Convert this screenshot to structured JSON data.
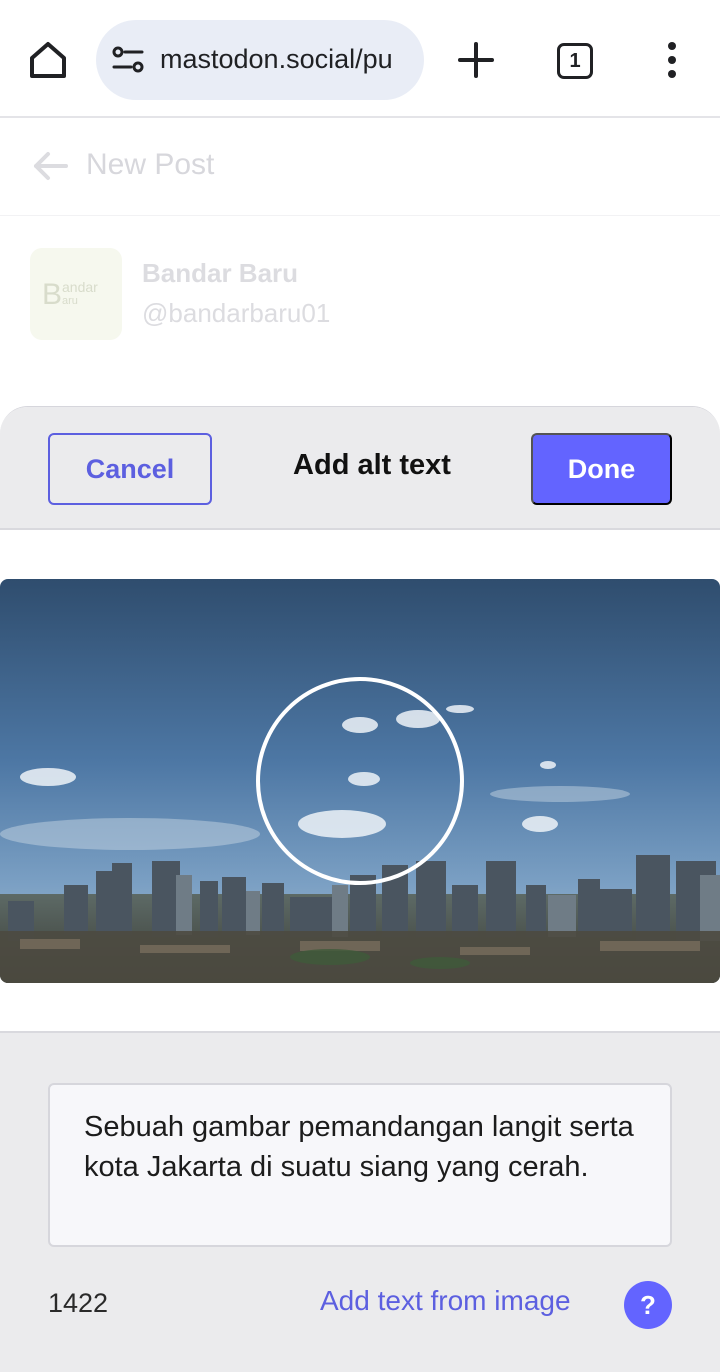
{
  "browser": {
    "url": "mastodon.social/pu",
    "tab_count": "1",
    "icons": [
      "home-icon",
      "site-settings-icon",
      "new-tab-icon",
      "tab-switcher-icon",
      "more-vert-icon"
    ]
  },
  "page": {
    "title": "New Post",
    "account": {
      "display_name": "Bandar Baru",
      "handle": "@bandarbaru01",
      "avatar_text_big": "B",
      "avatar_text_small_1": "andar",
      "avatar_text_small_2": "aru"
    }
  },
  "modal": {
    "cancel_label": "Cancel",
    "title": "Add alt text",
    "done_label": "Done",
    "alt_text_value": "Sebuah gambar pemandangan langit serta kota Jakarta di suatu siang yang cerah.",
    "char_count": "1422",
    "ocr_label": "Add text from image",
    "help_label": "?"
  },
  "colors": {
    "accent": "#6364ff",
    "link": "#5c5fe0",
    "sheet_bg": "#ebebed"
  }
}
